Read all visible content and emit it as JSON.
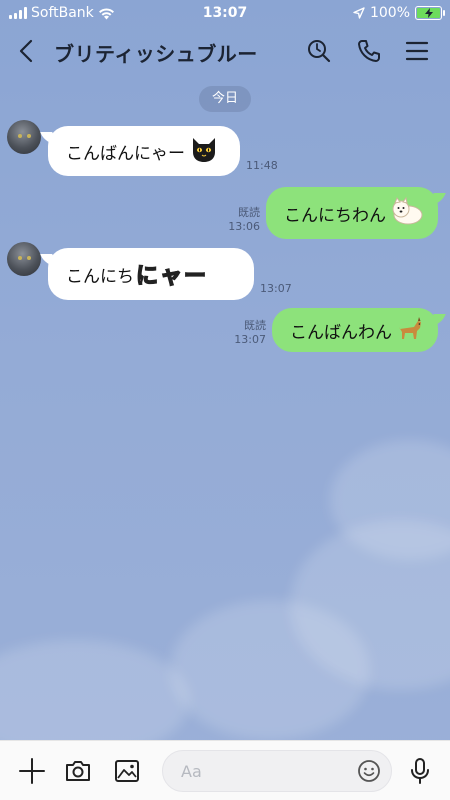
{
  "status_bar": {
    "carrier": "SoftBank",
    "time": "13:07",
    "battery": "100%"
  },
  "header": {
    "title": "ブリティッシュブルー"
  },
  "date_separator": "今日",
  "messages": [
    {
      "side": "in",
      "text": "こんばんにゃー",
      "sticker": "black-cat-emoji",
      "time": "11:48"
    },
    {
      "side": "out",
      "text": "こんにちわん",
      "sticker": "white-dog-emoji",
      "read": "既読",
      "time": "13:06"
    },
    {
      "side": "in",
      "text": "こんにち",
      "sticker": "nya-text-sticker",
      "sticker_text": [
        "に",
        "ャ",
        "ー"
      ],
      "time": "13:07"
    },
    {
      "side": "out",
      "text": "こんばんわん",
      "sticker": "brown-dog-emoji",
      "read": "既読",
      "time": "13:07"
    }
  ],
  "input": {
    "placeholder": "Aa"
  },
  "colors": {
    "background": "#94abd6",
    "out_bubble": "#8de27b",
    "in_bubble": "#ffffff",
    "header_text": "#1c2433"
  }
}
